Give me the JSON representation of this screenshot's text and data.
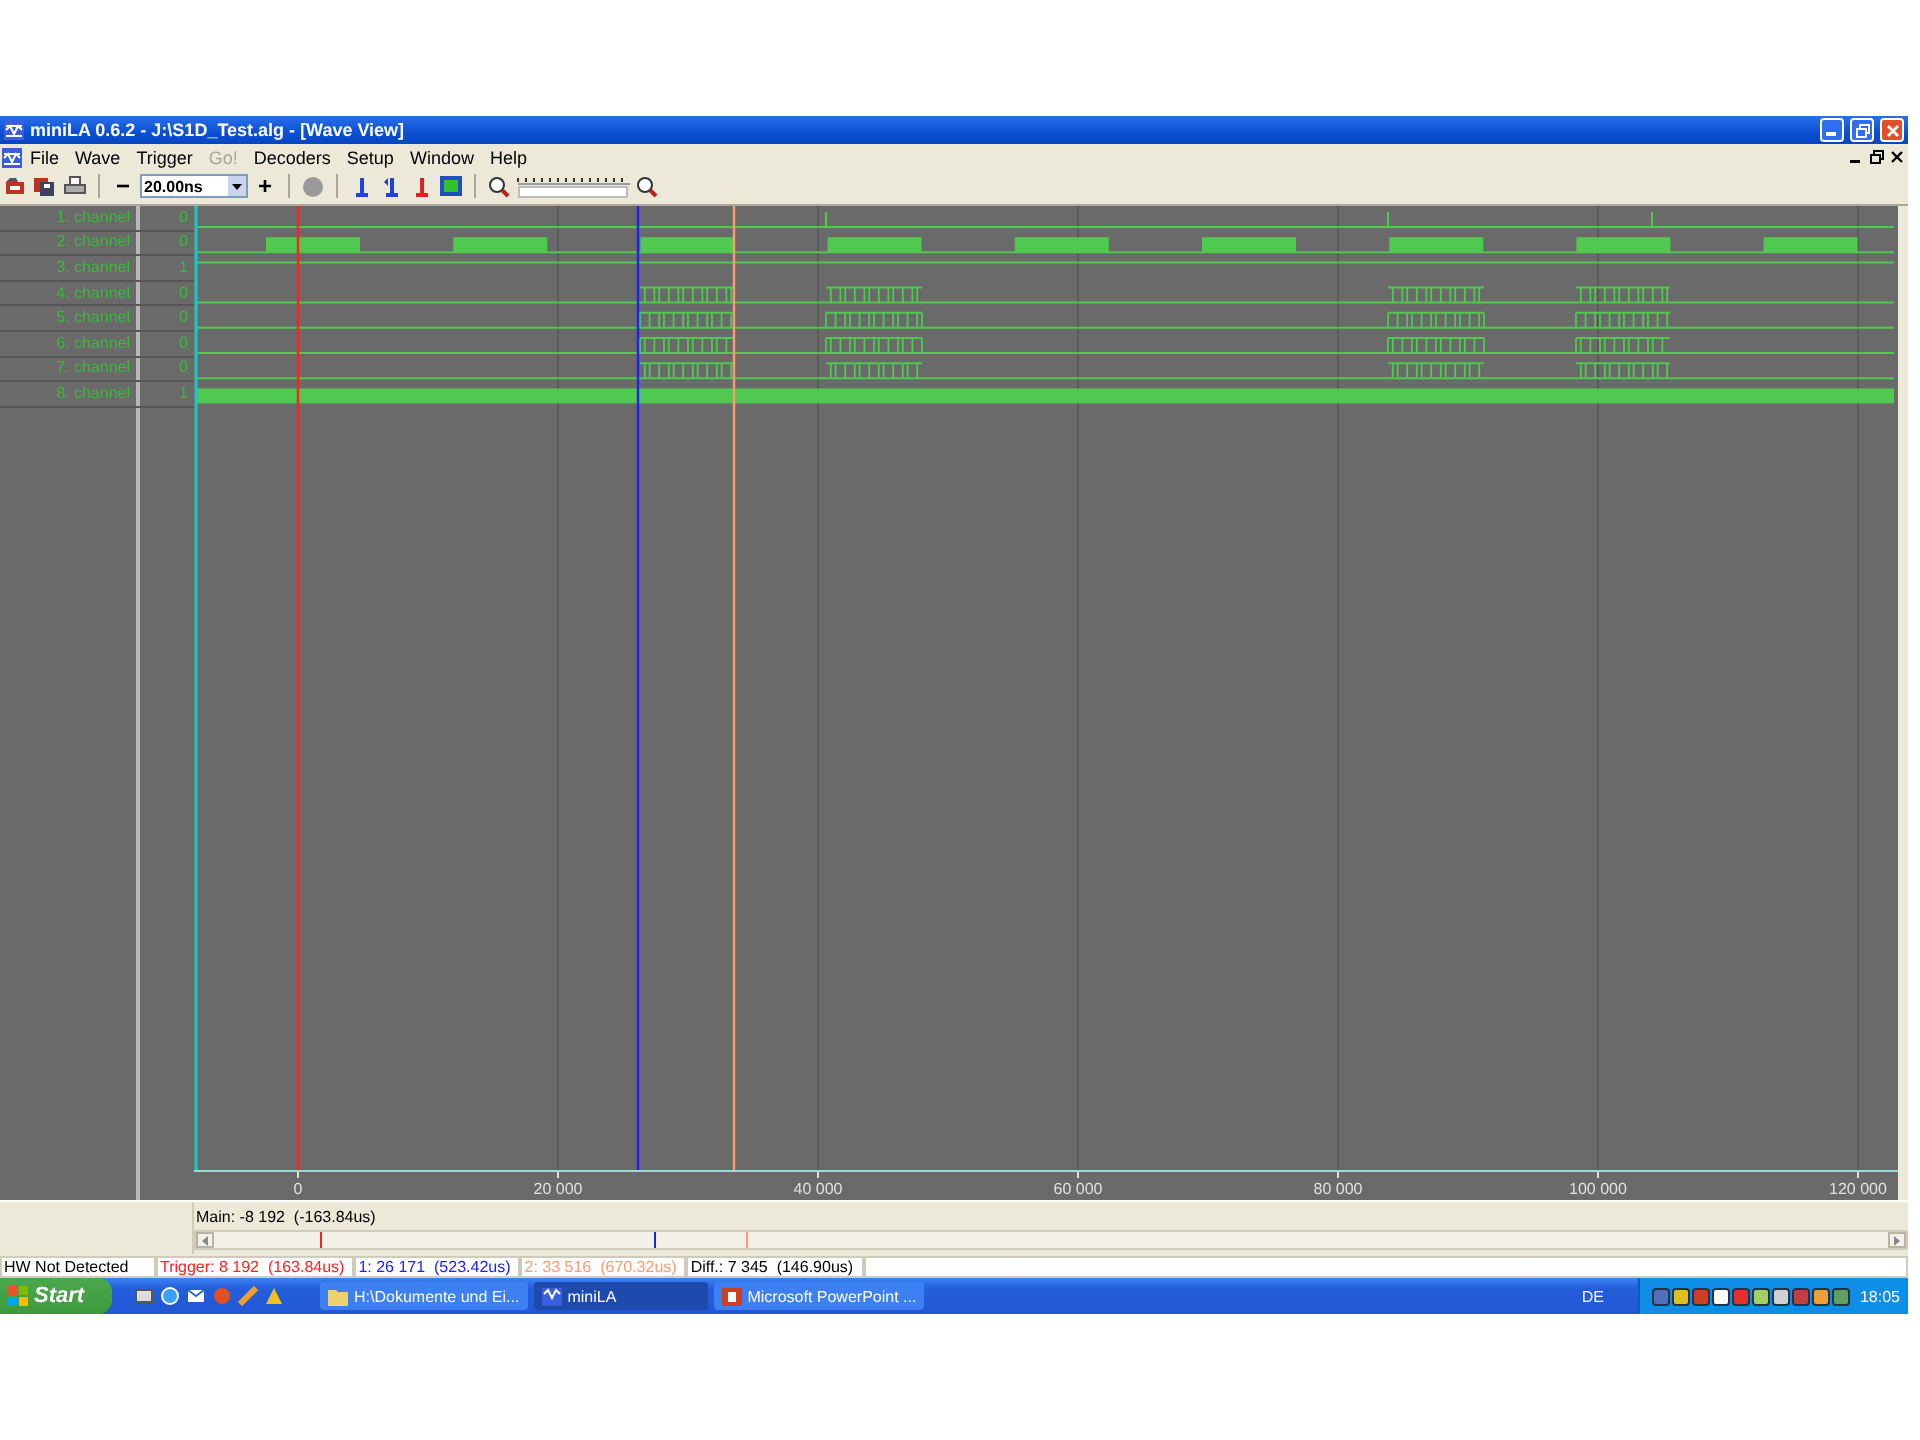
{
  "window": {
    "title": "miniLA 0.6.2 - J:\\S1D_Test.alg - [Wave View]"
  },
  "menu": [
    {
      "label": "File",
      "disabled": false
    },
    {
      "label": "Wave",
      "disabled": false
    },
    {
      "label": "Trigger",
      "disabled": false
    },
    {
      "label": "Go!",
      "disabled": true
    },
    {
      "label": "Decoders",
      "disabled": false
    },
    {
      "label": "Setup",
      "disabled": false
    },
    {
      "label": "Window",
      "disabled": false
    },
    {
      "label": "Help",
      "disabled": false
    }
  ],
  "toolbar": {
    "zoom_out": "−",
    "zoom_value": "20.00ns",
    "zoom_in": "+"
  },
  "channels": [
    {
      "name": "1. channel",
      "value": "0"
    },
    {
      "name": "2. channel",
      "value": "0"
    },
    {
      "name": "3. channel",
      "value": "1"
    },
    {
      "name": "4. channel",
      "value": "0"
    },
    {
      "name": "5. channel",
      "value": "0"
    },
    {
      "name": "6. channel",
      "value": "0"
    },
    {
      "name": "7. channel",
      "value": "0"
    },
    {
      "name": "8. channel",
      "value": "1"
    }
  ],
  "axis": {
    "ticks": [
      "0",
      "20 000",
      "40 000",
      "60 000",
      "80 000",
      "100 000",
      "120 000"
    ]
  },
  "main_position": "Main: -8 192  (-163.84us)",
  "status_bar": [
    {
      "text": "HW Not Detected"
    },
    {
      "text": "Trigger: 8 192  (163.84us)",
      "color": "#ff2020"
    },
    {
      "text": "1: 26 171  (523.42us)",
      "color": "#2020ff"
    },
    {
      "text": "2: 33 516  (670.32us)",
      "color": "#ff9a70"
    },
    {
      "text": "Diff.: 7 345  (146.90us)"
    }
  ],
  "taskbar": {
    "start": "Start",
    "tasks": [
      {
        "label": "H:\\Dokumente und Ei...",
        "selected": false
      },
      {
        "label": "miniLA",
        "selected": true
      },
      {
        "label": "Microsoft PowerPoint ...",
        "selected": false
      }
    ],
    "language": "DE",
    "clock": "18:05"
  }
}
